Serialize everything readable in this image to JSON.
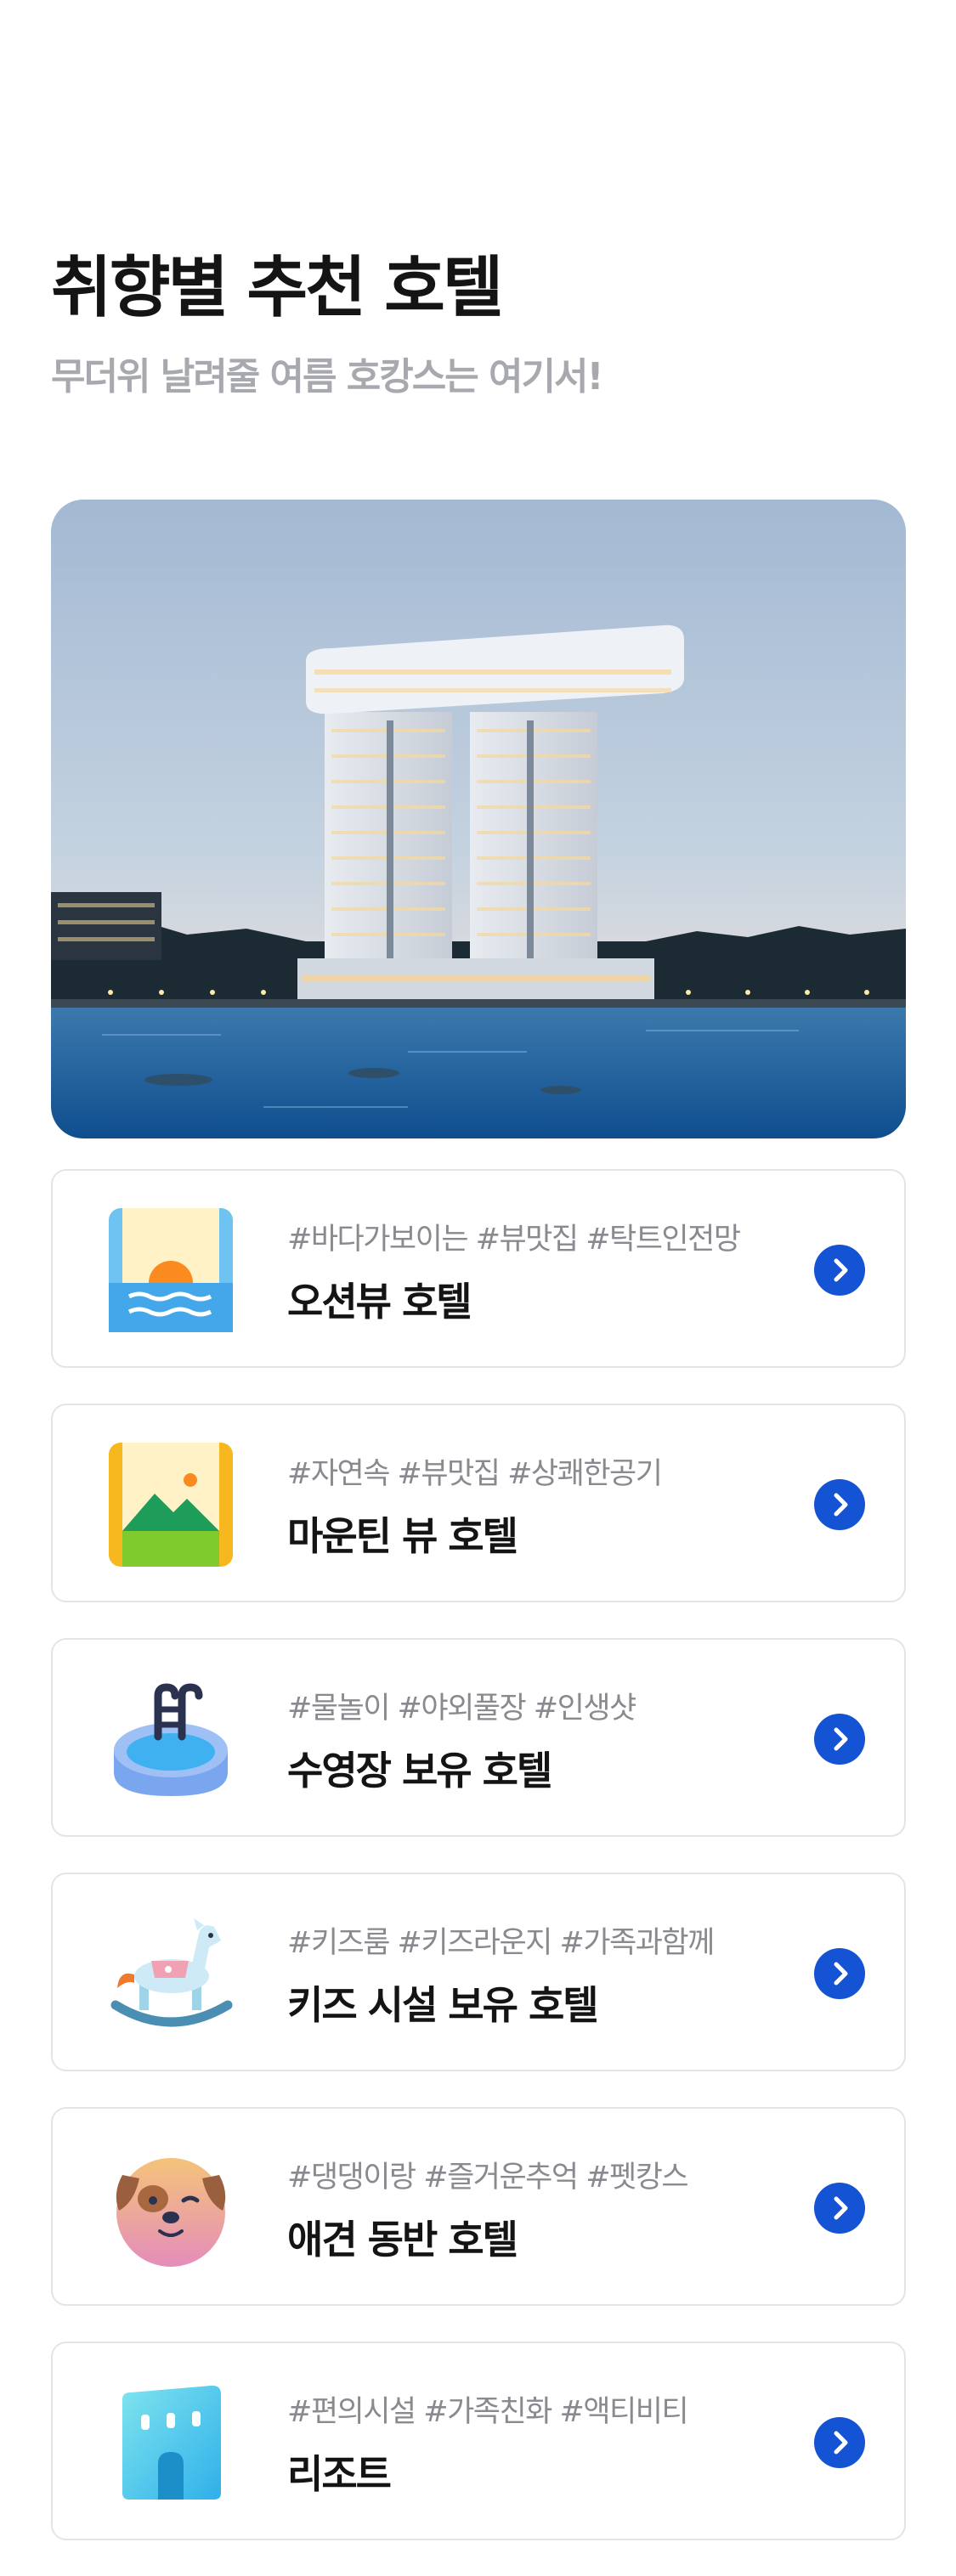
{
  "header": {
    "title": "취향별 추천 호텔",
    "subtitle": "무더위 날려줄 여름 호캉스는 여기서!"
  },
  "hero": {
    "image_name": "seaside-hotel-photo"
  },
  "categories": [
    {
      "tags": "#바다가보이는 #뷰맛집 #탁트인전망",
      "name": "오션뷰 호텔",
      "icon": "ocean-sunset-icon"
    },
    {
      "tags": "#자연속 #뷰맛집 #상쾌한공기",
      "name": "마운틴 뷰 호텔",
      "icon": "mountain-icon"
    },
    {
      "tags": "#물놀이 #야외풀장 #인생샷",
      "name": "수영장 보유 호텔",
      "icon": "pool-icon"
    },
    {
      "tags": "#키즈룸 #키즈라운지 #가족과함께",
      "name": "키즈 시설 보유 호텔",
      "icon": "rocking-horse-icon"
    },
    {
      "tags": "#댕댕이랑 #즐거운추억 #펫캉스",
      "name": "애견 동반 호텔",
      "icon": "dog-face-icon"
    },
    {
      "tags": "#편의시설 #가족친화 #액티비티",
      "name": "리조트",
      "icon": "resort-building-icon"
    }
  ],
  "colors": {
    "accent": "#1453d4",
    "title": "#141414",
    "subtitle": "#a7a9ae",
    "tags": "#888a8f",
    "border": "#e4e4e6"
  }
}
